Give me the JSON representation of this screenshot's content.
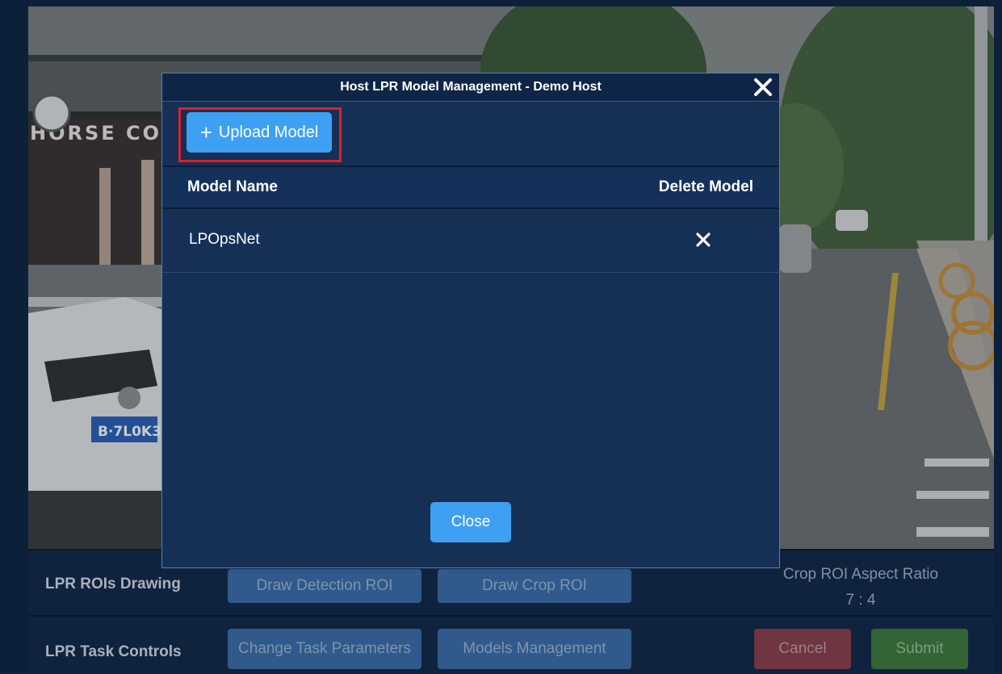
{
  "modal": {
    "title": "Host LPR Model Management - Demo Host",
    "upload_label": "Upload Model",
    "upload_icon": "plus-icon",
    "columns": [
      "Model Name",
      "Delete Model"
    ],
    "rows": [
      {
        "name": "LPOpsNet",
        "delete_icon": "x-icon"
      }
    ],
    "close_label": "Close"
  },
  "panel": {
    "rois": {
      "label": "LPR ROIs Drawing",
      "draw_detection_label": "Draw Detection ROI",
      "draw_crop_label": "Draw Crop ROI",
      "aspect_title": "Crop ROI Aspect Ratio",
      "aspect_value": "7 : 4"
    },
    "tasks": {
      "label": "LPR Task Controls",
      "change_params_label": "Change Task Parameters",
      "models_label": "Models Management",
      "cancel_label": "Cancel",
      "submit_label": "Submit"
    }
  },
  "camera": {
    "plate_text": "B·7L0K3",
    "shop_sign": "HORSE COF"
  },
  "colors": {
    "accent": "#3ea0f2",
    "highlight": "#e01f26",
    "modal_bg": "#162f55",
    "page_bg": "#0f2440"
  }
}
